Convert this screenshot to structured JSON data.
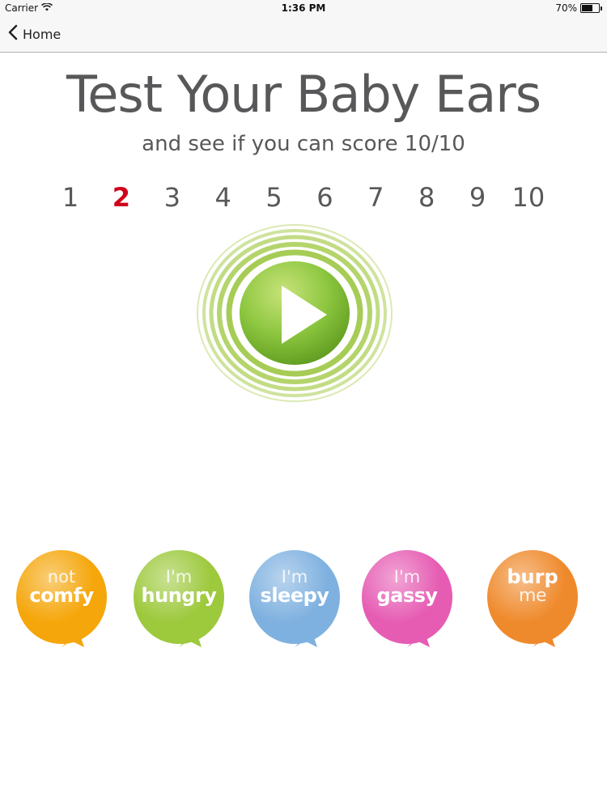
{
  "status": {
    "carrier": "Carrier",
    "time": "1:36 PM",
    "battery": "70%",
    "battery_level": 0.7
  },
  "nav": {
    "back_label": "Home"
  },
  "header": {
    "title": "Test Your Baby Ears",
    "subtitle": "and see if you can score 10/10"
  },
  "questions": {
    "numbers": [
      "1",
      "2",
      "3",
      "4",
      "5",
      "6",
      "7",
      "8",
      "9",
      "10"
    ],
    "current": "2"
  },
  "answers": [
    {
      "top": "not",
      "bottom": "comfy",
      "color": "#f5a60a"
    },
    {
      "top": "I'm",
      "bottom": "hungry",
      "color": "#9dc93c"
    },
    {
      "top": "I'm",
      "bottom": "sleepy",
      "color": "#7fb1e0"
    },
    {
      "top": "I'm",
      "bottom": "gassy",
      "color": "#e65cb3"
    },
    {
      "top": "burp",
      "bottom": "me",
      "color": "#ef8a2c"
    }
  ],
  "colors": {
    "play_green": "#8cc63f",
    "ring_green": "#b5d56a",
    "current_number": "#d0021b",
    "text_gray": "#58585a"
  }
}
